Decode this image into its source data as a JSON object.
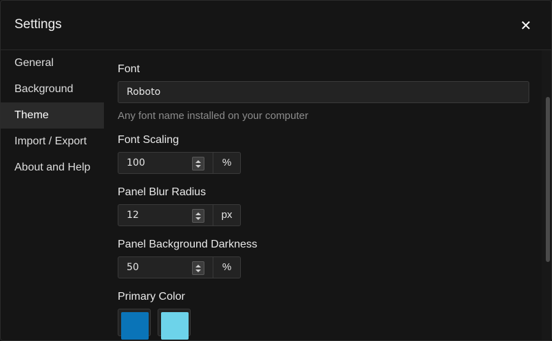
{
  "dialog": {
    "title": "Settings",
    "close_symbol": "✕"
  },
  "sidebar": {
    "items": [
      {
        "label": "General"
      },
      {
        "label": "Background"
      },
      {
        "label": "Theme",
        "active": true
      },
      {
        "label": "Import / Export"
      },
      {
        "label": "About and Help"
      }
    ]
  },
  "theme": {
    "font": {
      "label": "Font",
      "value": "Roboto",
      "hint": "Any font name installed on your computer"
    },
    "font_scaling": {
      "label": "Font Scaling",
      "value": "100",
      "unit": "%"
    },
    "panel_blur_radius": {
      "label": "Panel Blur Radius",
      "value": "12",
      "unit": "px"
    },
    "panel_background_darkness": {
      "label": "Panel Background Darkness",
      "value": "50",
      "unit": "%"
    },
    "primary_color": {
      "label": "Primary Color",
      "swatches": [
        "#0a74b8",
        "#6dd3ea"
      ]
    }
  },
  "colors": {
    "background": "#151515",
    "active_nav": "#2a2a2a"
  }
}
